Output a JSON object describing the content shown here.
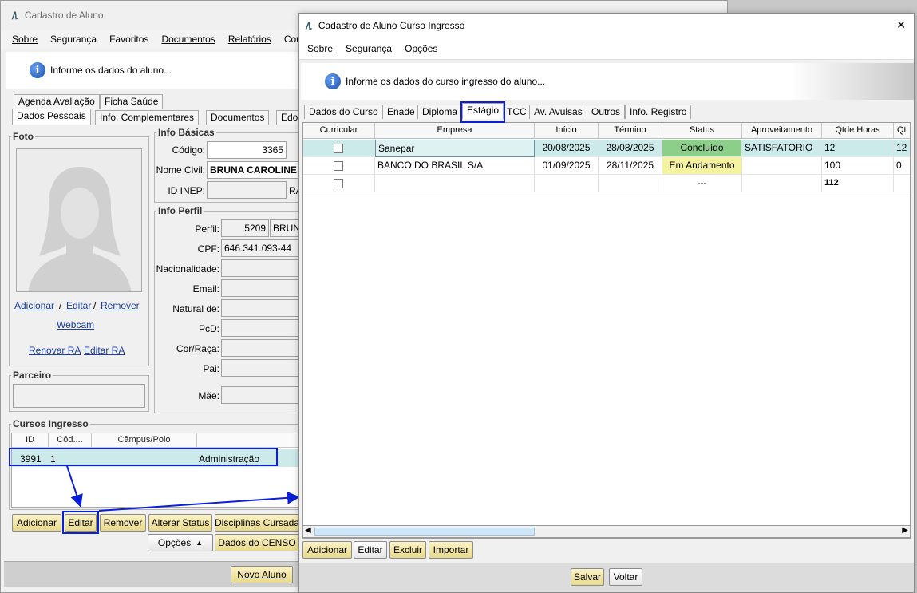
{
  "back_window": {
    "title": "Cadastro de Aluno",
    "logo": "/\\.",
    "menu": [
      "Sobre",
      "Segurança",
      "Favoritos",
      "Documentos",
      "Relatórios",
      "Con"
    ],
    "info_text": "Informe os dados do aluno...",
    "tabs_row1": [
      "Agenda Avaliação",
      "Ficha Saúde"
    ],
    "tabs_row2": [
      "Dados Pessoais",
      "Info. Complementares",
      "Documentos",
      "Edo"
    ],
    "foto": {
      "title": "Foto",
      "add": "Adicionar",
      "sep": "/",
      "edit": "Editar",
      "remove": "Remover",
      "webcam": "Webcam",
      "renew_ra": "Renovar RA",
      "edit_ra": "Editar RA"
    },
    "parceiro_title": "Parceiro",
    "info_basicas": {
      "title": "Info Básicas",
      "codigo_label": "Código:",
      "codigo": "3365",
      "nome_label": "Nome Civil:",
      "nome": "BRUNA CAROLINE A",
      "inep_label": "ID INEP:",
      "ra_label": "RA"
    },
    "info_perfil": {
      "title": "Info Perfil",
      "perfil_label": "Perfil:",
      "perfil_code": "5209",
      "perfil_name": "BRUNA",
      "cpf_label": "CPF:",
      "cpf": "646.341.093-44",
      "nacionalidade_label": "Nacionalidade:",
      "email_label": "Email:",
      "natural_label": "Natural de:",
      "pcd_label": "PcD:",
      "cor_label": "Cor/Raça:",
      "pai_label": "Pai:",
      "mae_label": "Mãe:"
    },
    "cursos": {
      "title": "Cursos Ingresso",
      "headers": [
        "ID",
        "Cód....",
        "Câmpus/Polo",
        ""
      ],
      "row": [
        "3991",
        "1",
        "",
        "Administração"
      ]
    },
    "buttons": {
      "add": "Adicionar",
      "edit": "Editar",
      "remove": "Remover",
      "status": "Alterar Status",
      "disciplinas": "Disciplinas Cursada",
      "opcoes": "Opções",
      "censo": "Dados do CENSO",
      "novo": "Novo Aluno"
    }
  },
  "front_window": {
    "title": "Cadastro de Aluno Curso Ingresso",
    "close": "✕",
    "menu": [
      "Sobre",
      "Segurança",
      "Opções"
    ],
    "info_text": "Informe os dados do curso ingresso do aluno...",
    "tabs": [
      "Dados do Curso",
      "Enade",
      "Diploma",
      "Estágio",
      "TCC",
      "Av. Avulsas",
      "Outros",
      "Info. Registro"
    ],
    "grid": {
      "headers": [
        "Curricular",
        "Empresa",
        "Início",
        "Término",
        "Status",
        "Aproveitamento",
        "Qtde Horas",
        "Qt"
      ],
      "rows": [
        {
          "curricular": "",
          "empresa": "Sanepar",
          "inicio": "20/08/2025",
          "termino": "28/08/2025",
          "status": "Concluído",
          "aproveitamento": "SATISFATORIO",
          "horas": "12",
          "qt": "12"
        },
        {
          "curricular": "",
          "empresa": "BANCO DO BRASIL S/A",
          "inicio": "01/09/2025",
          "termino": "28/11/2025",
          "status": "Em Andamento",
          "aproveitamento": "",
          "horas": "100",
          "qt": "0"
        },
        {
          "curricular": "",
          "empresa": "",
          "inicio": "",
          "termino": "",
          "status": "---",
          "aproveitamento": "",
          "horas": "112",
          "qt": ""
        }
      ]
    },
    "buttons": {
      "add": "Adicionar",
      "edit": "Editar",
      "delete": "Excluir",
      "import": "Importar",
      "save": "Salvar",
      "back": "Voltar"
    }
  },
  "colors": {
    "highlight": "#0a1fd6",
    "row_selected": "#cdeaea",
    "status_done": "#8ccf8a",
    "status_progress": "#f6f3a0",
    "button_yellow": "#f3e7a8"
  }
}
